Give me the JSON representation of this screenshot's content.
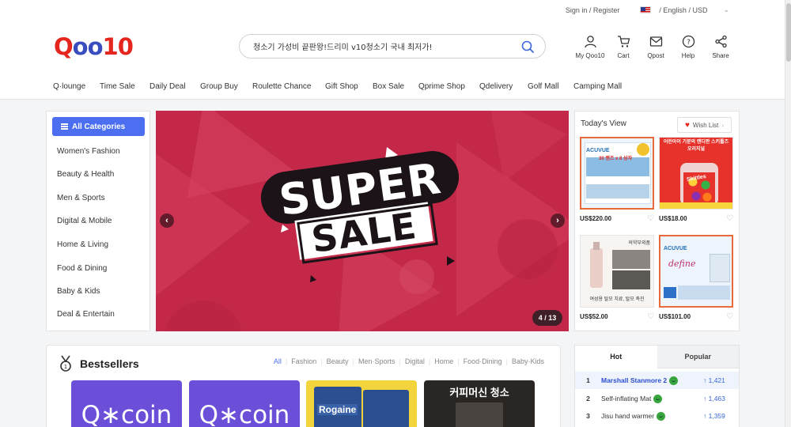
{
  "topbar": {
    "sign_in": "Sign in / Register",
    "locale": "/ English / USD"
  },
  "logo": {
    "part1": "Q",
    "part2": "oo",
    "part3": "10"
  },
  "search": {
    "value": "청소기 가성비 끝판왕!드리미 v10청소기 국내 최저가!"
  },
  "header_icons": [
    {
      "label": "My Qoo10",
      "icon": "user-icon"
    },
    {
      "label": "Cart",
      "icon": "cart-icon"
    },
    {
      "label": "Qpost",
      "icon": "mail-icon"
    },
    {
      "label": "Help",
      "icon": "help-icon"
    },
    {
      "label": "Share",
      "icon": "share-icon"
    }
  ],
  "menu": [
    "Q·lounge",
    "Time Sale",
    "Daily Deal",
    "Group Buy",
    "Roulette Chance",
    "Gift Shop",
    "Box Sale",
    "Qprime Shop",
    "Qdelivery",
    "Golf Mall",
    "Camping Mall"
  ],
  "categories": {
    "button": "All Categories",
    "items": [
      "Women's Fashion",
      "Beauty & Health",
      "Men & Sports",
      "Digital & Mobile",
      "Home & Living",
      "Food & Dining",
      "Baby & Kids",
      "Deal & Entertain"
    ]
  },
  "banner": {
    "line1": "SUPER",
    "line2": "SALE",
    "counter": "4 / 13",
    "prev": "‹",
    "next": "›"
  },
  "today_view": {
    "title": "Today's View",
    "wish_list": "Wish List",
    "products": [
      {
        "price": "US$220.00",
        "badge": "30 렌즈 x 8 상자",
        "brand": "ACUVUE"
      },
      {
        "price": "US$18.00",
        "badge": "어린아이 기분의 캔디판 스키틀즈 오리지널",
        "brand": "Skittles"
      },
      {
        "price": "US$52.00",
        "badge": "의약부외품",
        "caption": "여성용 탈모 치료, 탈모 촉진"
      },
      {
        "price": "US$101.00",
        "badge": "ACUVUE",
        "brand": "define"
      }
    ]
  },
  "bestsellers": {
    "title": "Bestsellers",
    "tabs": [
      "All",
      "Fashion",
      "Beauty",
      "Men·Sports",
      "Digital",
      "Home",
      "Food·Dining",
      "Baby·Kids"
    ],
    "items": [
      {
        "text": "Q∗coin"
      },
      {
        "text": "Q∗coin"
      },
      {
        "text": "Rogaine"
      },
      {
        "text": "커피머신 청소"
      }
    ]
  },
  "hot": {
    "tabs": [
      "Hot",
      "Popular"
    ],
    "rows": [
      {
        "rank": "1",
        "name": "Marshall Stanmore 2",
        "count": "↑ 1,421"
      },
      {
        "rank": "2",
        "name": "Self-inflating Mat",
        "count": "↑ 1,463"
      },
      {
        "rank": "3",
        "name": "Jisu hand warmer",
        "count": "↑ 1,359"
      }
    ]
  }
}
